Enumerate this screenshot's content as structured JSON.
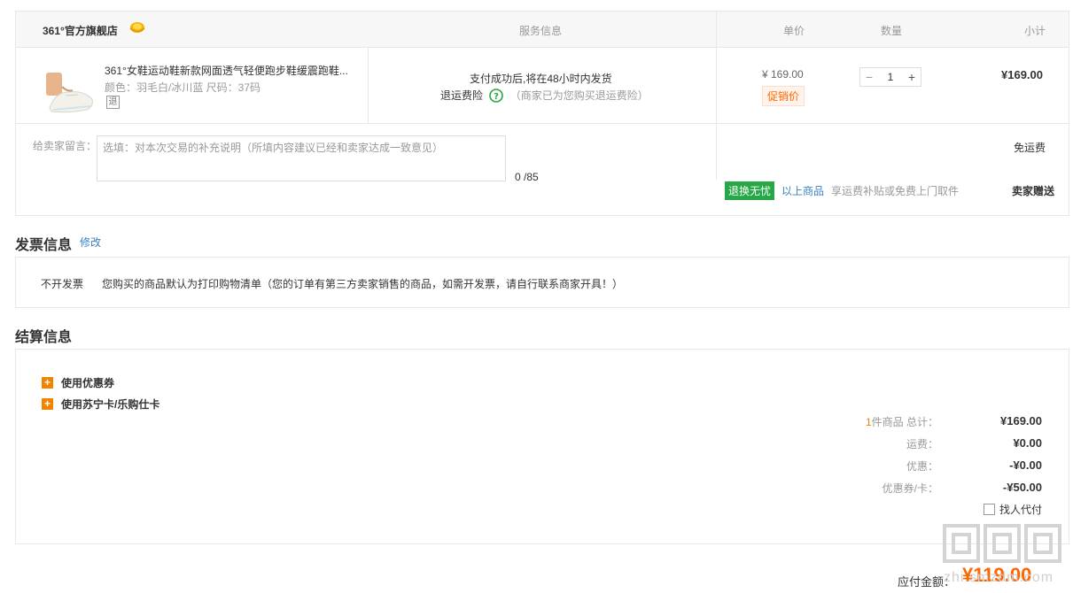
{
  "store": {
    "name": "361°官方旗舰店",
    "icon": "store-badge-icon"
  },
  "headers": {
    "service": "服务信息",
    "unit_price": "单价",
    "quantity": "数量",
    "subtotal": "小计"
  },
  "product": {
    "name": "361°女鞋运动鞋新款网面透气轻便跑步鞋缓震跑鞋...",
    "spec": "颜色：羽毛白/冰川蓝   尺码：37码",
    "tag": "退"
  },
  "service": {
    "line1": "支付成功后,将在48小时内发货",
    "insurance_label": "退运费险",
    "insurance_note": "（商家已为您购买退运费险）"
  },
  "price": {
    "unit": "¥ 169.00",
    "promo": "促销价"
  },
  "quantity": {
    "minus": "−",
    "value": "1",
    "plus": "+"
  },
  "subtotal": "¥169.00",
  "message": {
    "label": "给卖家留言：",
    "placeholder": "选填：对本次交易的补充说明（所填内容建议已经和卖家达成一致意见）",
    "count": "0 /85"
  },
  "shipping": {
    "free": "免运费",
    "worry_badge": "退换无忧",
    "above_goods": "以上商品",
    "note": "享运费补贴或免费上门取件",
    "seller_gift": "卖家赠送"
  },
  "invoice": {
    "title": "发票信息",
    "edit": "修改",
    "type": "不开发票",
    "desc": "您购买的商品默认为打印购物清单（您的订单有第三方卖家销售的商品，如需开发票，请自行联系商家开具！）"
  },
  "settlement": {
    "title": "结算信息",
    "coupon": "使用优惠券",
    "card": "使用苏宁卡/乐购仕卡",
    "count": "1",
    "items_total_label": "件商品 总计：",
    "items_total": "¥169.00",
    "shipping_label": "运费：",
    "shipping": "¥0.00",
    "discount_label": "优惠：",
    "discount": "-¥0.00",
    "coupon_label": "优惠券/卡：",
    "coupon_value": "-¥50.00",
    "pay_for_me": "找人代付"
  },
  "payable": {
    "label": "应付金额：",
    "value": "¥119.00"
  },
  "watermark": {
    "text": "zhi.smzdm.com"
  },
  "colors": {
    "accent": "#ff6600",
    "link": "#3a82c4",
    "green": "#25a845",
    "orange": "#f08300"
  }
}
